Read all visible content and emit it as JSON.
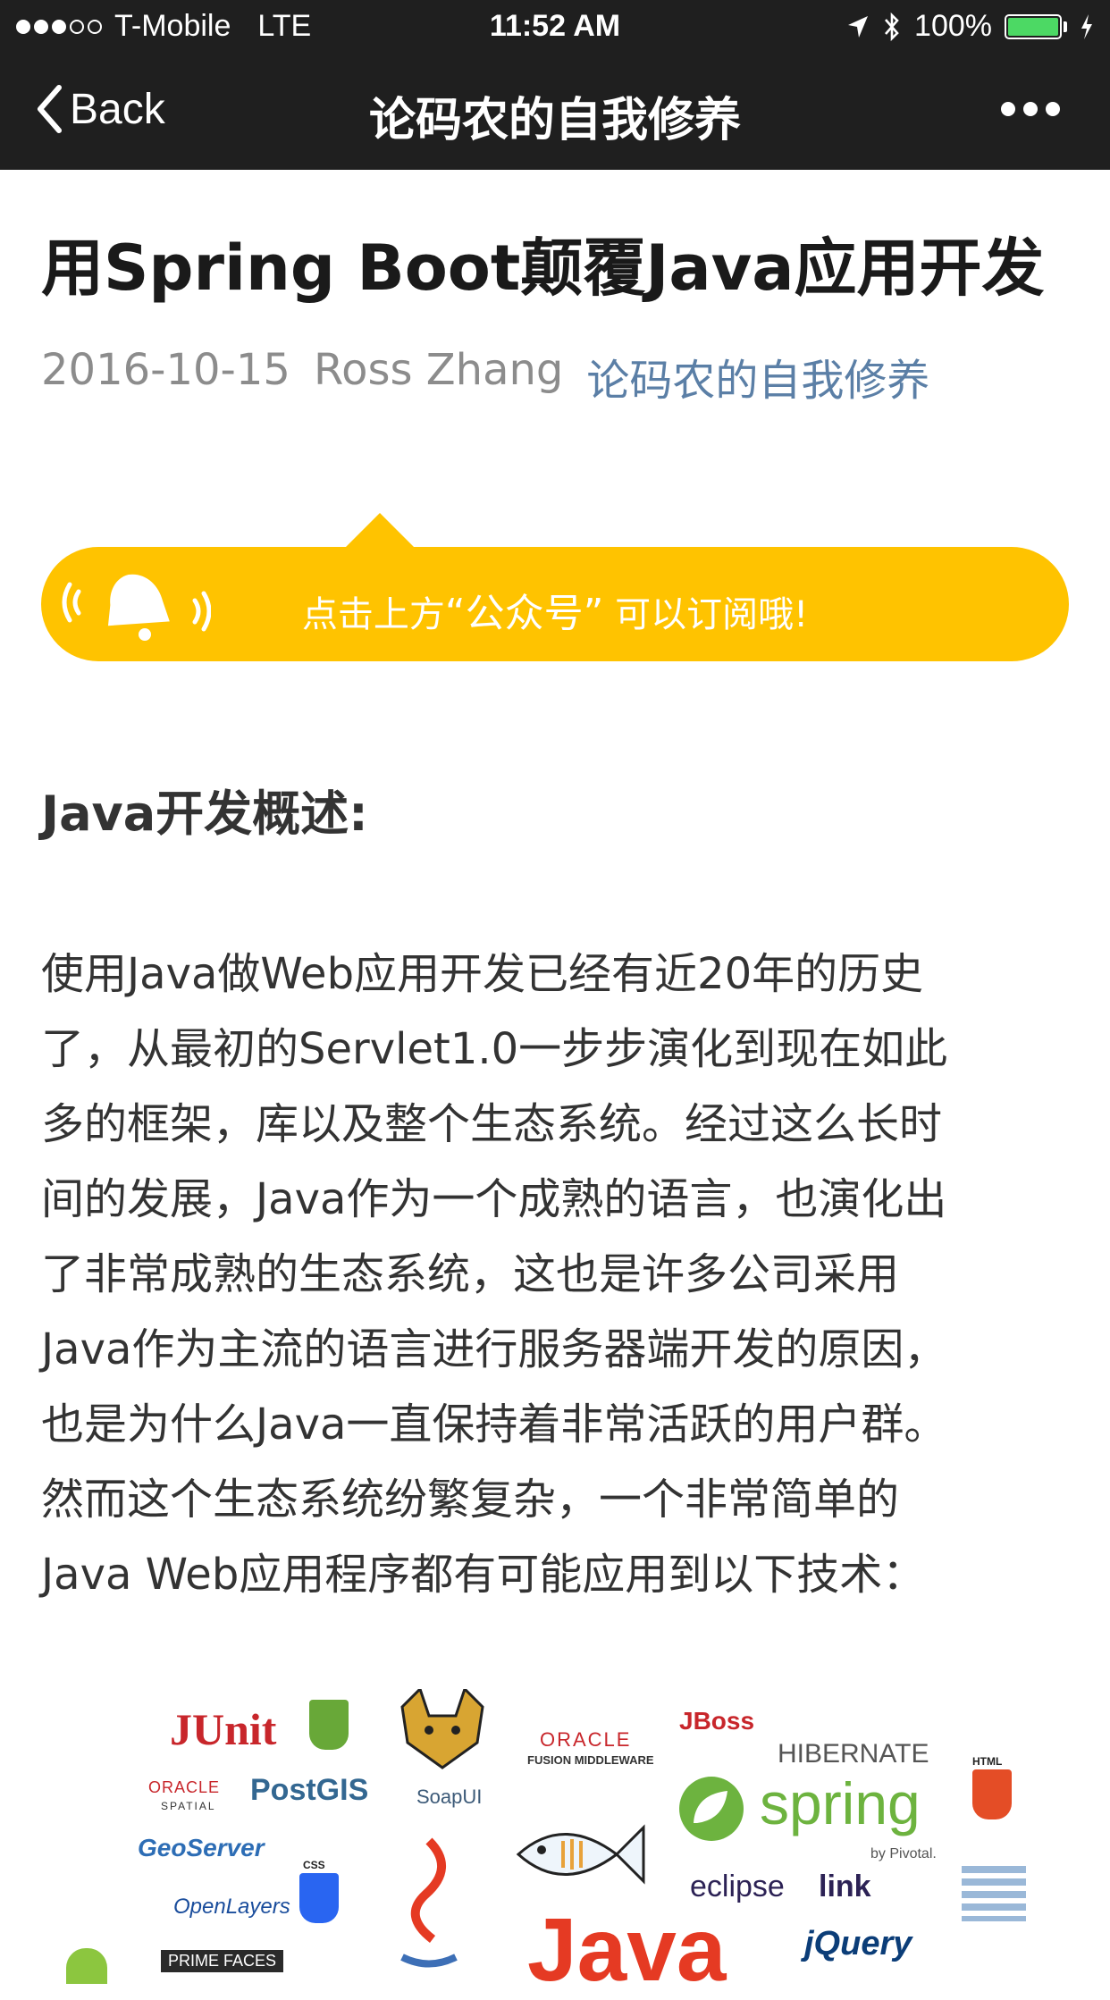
{
  "status_bar": {
    "carrier": "T-Mobile",
    "network": "LTE",
    "time": "11:52 AM",
    "battery": "100%",
    "signal_bars": 3
  },
  "nav": {
    "back_label": "Back",
    "title": "论码农的自我修养"
  },
  "article": {
    "title": "用Spring Boot颠覆Java应用开发",
    "date": "2016-10-15",
    "author": "Ross Zhang",
    "account": "论码农的自我修养"
  },
  "banner": {
    "text_before": "点击上方",
    "text_quoted": "“公众号”",
    "text_after": " 可以订阅哦!"
  },
  "section_heading": "Java开发概述:",
  "body_lines": [
    "使用Java做Web应用开发已经有近20年的历史",
    "了，从最初的Servlet1.0一步步演化到现在如此",
    "多的框架，库以及整个生态系统。经过这么长时",
    "间的发展，Java作为一个成熟的语言，也演化出",
    "了非常成熟的生态系统，这也是许多公司采用",
    "Java作为主流的语言进行服务器端开发的原因，",
    "也是为什么Java一直保持着非常活跃的用户群。",
    "然而这个生态系统纷繁复杂，一个非常简单的",
    "Java Web应用程序都有可能应用到以下技术："
  ],
  "logos": {
    "junit": "JUnit",
    "oracle_fusion": "ORACLE",
    "oracle_fusion_sub": "FUSION MIDDLEWARE",
    "jboss": "JBoss",
    "hibernate": "HIBERNATE",
    "html5": "HTML",
    "oracle_spatial": "ORACLE",
    "oracle_spatial_sub": "SPATIAL",
    "postgis": "PostGIS",
    "soapui": "SoapUI",
    "spring": "spring",
    "pivotal": "by Pivotal.",
    "geoserver": "GeoServer",
    "openlayers": "OpenLayers",
    "css": "CSS",
    "eclipselink": "eclipse",
    "eclipselink_link": "link",
    "java": "Java",
    "jquery": "jQuery",
    "primefaces": "PRIME FACES"
  },
  "colors": {
    "bar_bg": "#1f1f1f",
    "banner": "#ffc300",
    "account_link": "#5b7fa6",
    "meta_gray": "#8c8c8c",
    "body_text": "#333333"
  }
}
